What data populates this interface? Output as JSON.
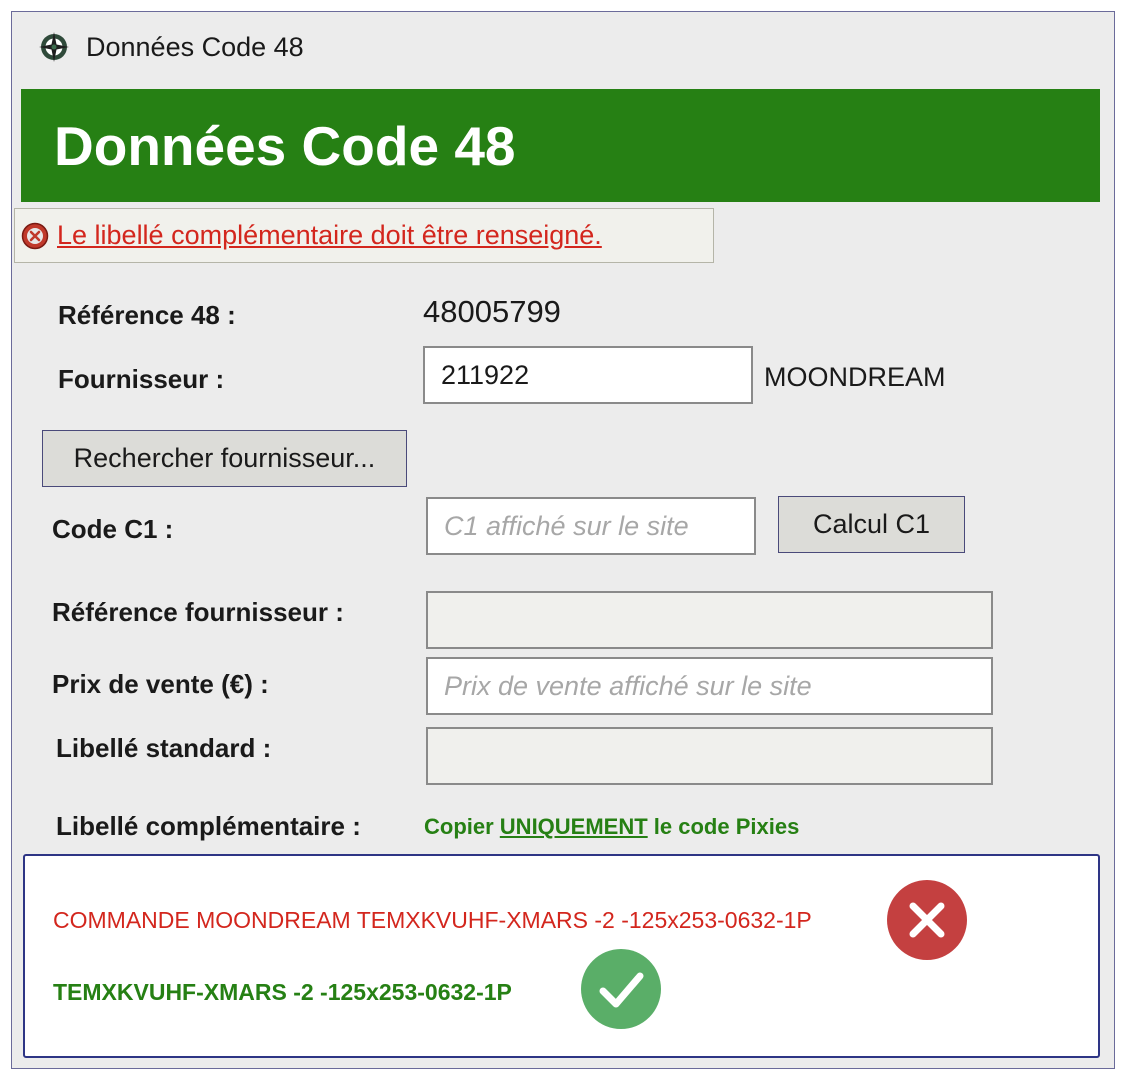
{
  "window": {
    "title": "Données Code 48"
  },
  "header": {
    "title": "Données Code 48"
  },
  "error": {
    "message": "Le libellé complémentaire doit être renseigné."
  },
  "form": {
    "reference_label": "Référence 48 :",
    "reference_value": "48005799",
    "supplier_label": "Fournisseur :",
    "supplier_value": "211922",
    "supplier_name": "MOONDREAM",
    "search_supplier_button": "Rechercher fournisseur...",
    "c1_label": "Code C1 :",
    "c1_value": "",
    "c1_placeholder": "C1 affiché sur le site",
    "calc_c1_button": "Calcul C1",
    "supplier_ref_label": "Référence fournisseur :",
    "supplier_ref_value": "",
    "price_label": "Prix de vente (€) :",
    "price_value": "",
    "price_placeholder": "Prix de vente affiché sur le site",
    "standard_label_label": "Libellé standard :",
    "standard_label_value": "",
    "complementary_label_label": "Libellé complémentaire :",
    "hint_before": "Copier ",
    "hint_emphasis": "UNIQUEMENT",
    "hint_after": " le code Pixies"
  },
  "examples": {
    "bad": "COMMANDE MOONDREAM TEMXKVUHF-XMARS -2 -125x253-0632-1P",
    "good": "TEMXKVUHF-XMARS -2 -125x253-0632-1P"
  },
  "colors": {
    "header_bg": "#268014",
    "error_text": "#d3261d",
    "hint_text": "#268014",
    "bad_icon": "#c44040",
    "good_icon": "#5aae68"
  },
  "icons": {
    "app": "compass-icon",
    "error": "error-icon",
    "bad": "x-circle-icon",
    "good": "check-circle-icon"
  }
}
